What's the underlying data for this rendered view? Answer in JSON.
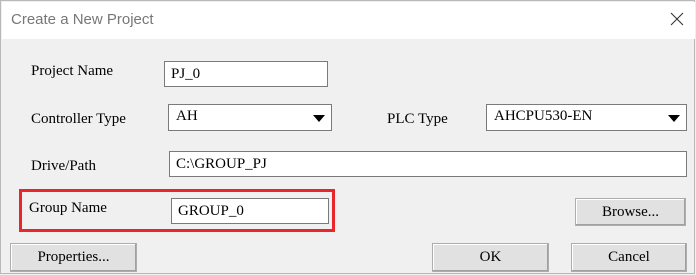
{
  "window": {
    "title": "Create a New Project",
    "close_icon": "close-icon"
  },
  "form": {
    "project_name": {
      "label": "Project Name",
      "value": "PJ_0"
    },
    "controller_type": {
      "label": "Controller Type",
      "value": "AH"
    },
    "plc_type": {
      "label": "PLC Type",
      "value": "AHCPU530-EN"
    },
    "drive_path": {
      "label": "Drive/Path",
      "value": "C:\\GROUP_PJ"
    },
    "group_name": {
      "label": "Group Name",
      "value": "GROUP_0"
    }
  },
  "buttons": {
    "browse": "Browse...",
    "properties": "Properties...",
    "ok": "OK",
    "cancel": "Cancel"
  },
  "colors": {
    "highlight": "#e8262b",
    "title_text": "#777777"
  }
}
